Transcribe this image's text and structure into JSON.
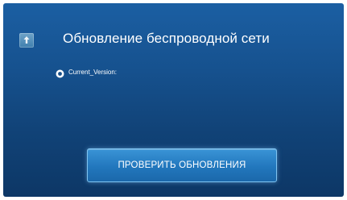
{
  "screen": {
    "title": "Обновление беспроводной сети",
    "header_icon": "network-update-icon",
    "version": {
      "icon": "version-info-icon",
      "label": "Current_Version:"
    },
    "check_button": {
      "label": "ПРОВЕРИТЬ ОБНОВЛЕНИЯ"
    }
  },
  "colors": {
    "background_top": "#1b5fa3",
    "background_bottom": "#0d3766",
    "button": "#2277bd",
    "button_border": "#7fc3f0",
    "text": "#ffffff"
  }
}
